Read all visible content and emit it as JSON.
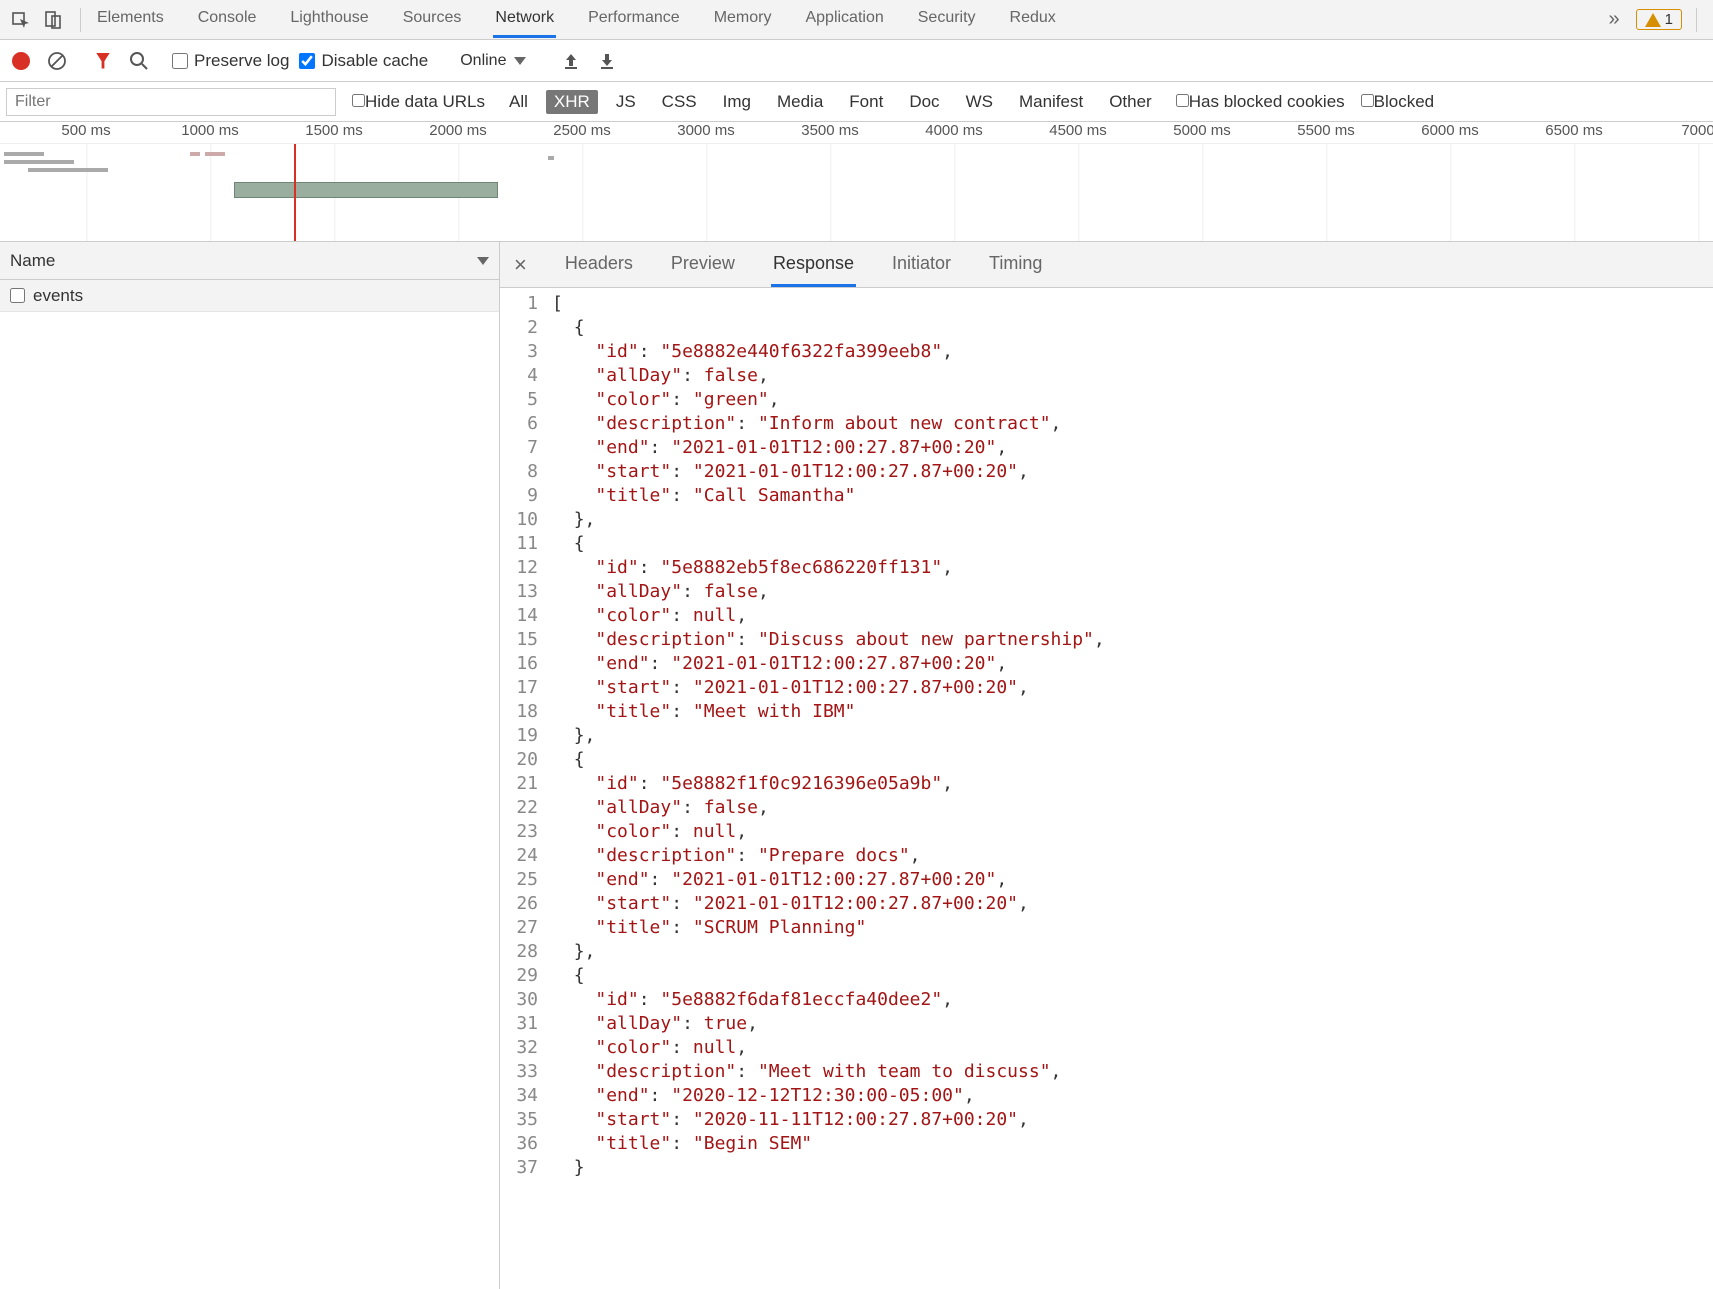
{
  "topTabs": [
    "Elements",
    "Console",
    "Lighthouse",
    "Sources",
    "Network",
    "Performance",
    "Memory",
    "Application",
    "Security",
    "Redux"
  ],
  "activeTopTab": "Network",
  "moreTabs": "»",
  "warnCount": "1",
  "controls": {
    "preserveLog": "Preserve log",
    "disableCache": "Disable cache",
    "throttling": "Online"
  },
  "filter": {
    "placeholder": "Filter",
    "hideDataUrls": "Hide data URLs",
    "types": [
      "All",
      "XHR",
      "JS",
      "CSS",
      "Img",
      "Media",
      "Font",
      "Doc",
      "WS",
      "Manifest",
      "Other"
    ],
    "activeType": "XHR",
    "hasBlockedCookies": "Has blocked cookies",
    "blocked": "Blocked"
  },
  "timeline": {
    "ticks": [
      "500 ms",
      "1000 ms",
      "1500 ms",
      "2000 ms",
      "2500 ms",
      "3000 ms",
      "3500 ms",
      "4000 ms",
      "4500 ms",
      "5000 ms",
      "5500 ms",
      "6000 ms",
      "6500 ms",
      "7000"
    ]
  },
  "leftPane": {
    "header": "Name",
    "requests": [
      "events"
    ]
  },
  "detailTabs": [
    "Headers",
    "Preview",
    "Response",
    "Initiator",
    "Timing"
  ],
  "activeDetailTab": "Response",
  "response": [
    {
      "id": "5e8882e440f6322fa399eeb8",
      "allDay": false,
      "color": "green",
      "description": "Inform about new contract",
      "end": "2021-01-01T12:00:27.87+00:20",
      "start": "2021-01-01T12:00:27.87+00:20",
      "title": "Call Samantha"
    },
    {
      "id": "5e8882eb5f8ec686220ff131",
      "allDay": false,
      "color": null,
      "description": "Discuss about new partnership",
      "end": "2021-01-01T12:00:27.87+00:20",
      "start": "2021-01-01T12:00:27.87+00:20",
      "title": "Meet with IBM"
    },
    {
      "id": "5e8882f1f0c9216396e05a9b",
      "allDay": false,
      "color": null,
      "description": "Prepare docs",
      "end": "2021-01-01T12:00:27.87+00:20",
      "start": "2021-01-01T12:00:27.87+00:20",
      "title": "SCRUM Planning"
    },
    {
      "id": "5e8882f6daf81eccfa40dee2",
      "allDay": true,
      "color": null,
      "description": "Meet with team to discuss",
      "end": "2020-12-12T12:30:00-05:00",
      "start": "2020-11-11T12:00:27.87+00:20",
      "title": "Begin SEM"
    }
  ]
}
